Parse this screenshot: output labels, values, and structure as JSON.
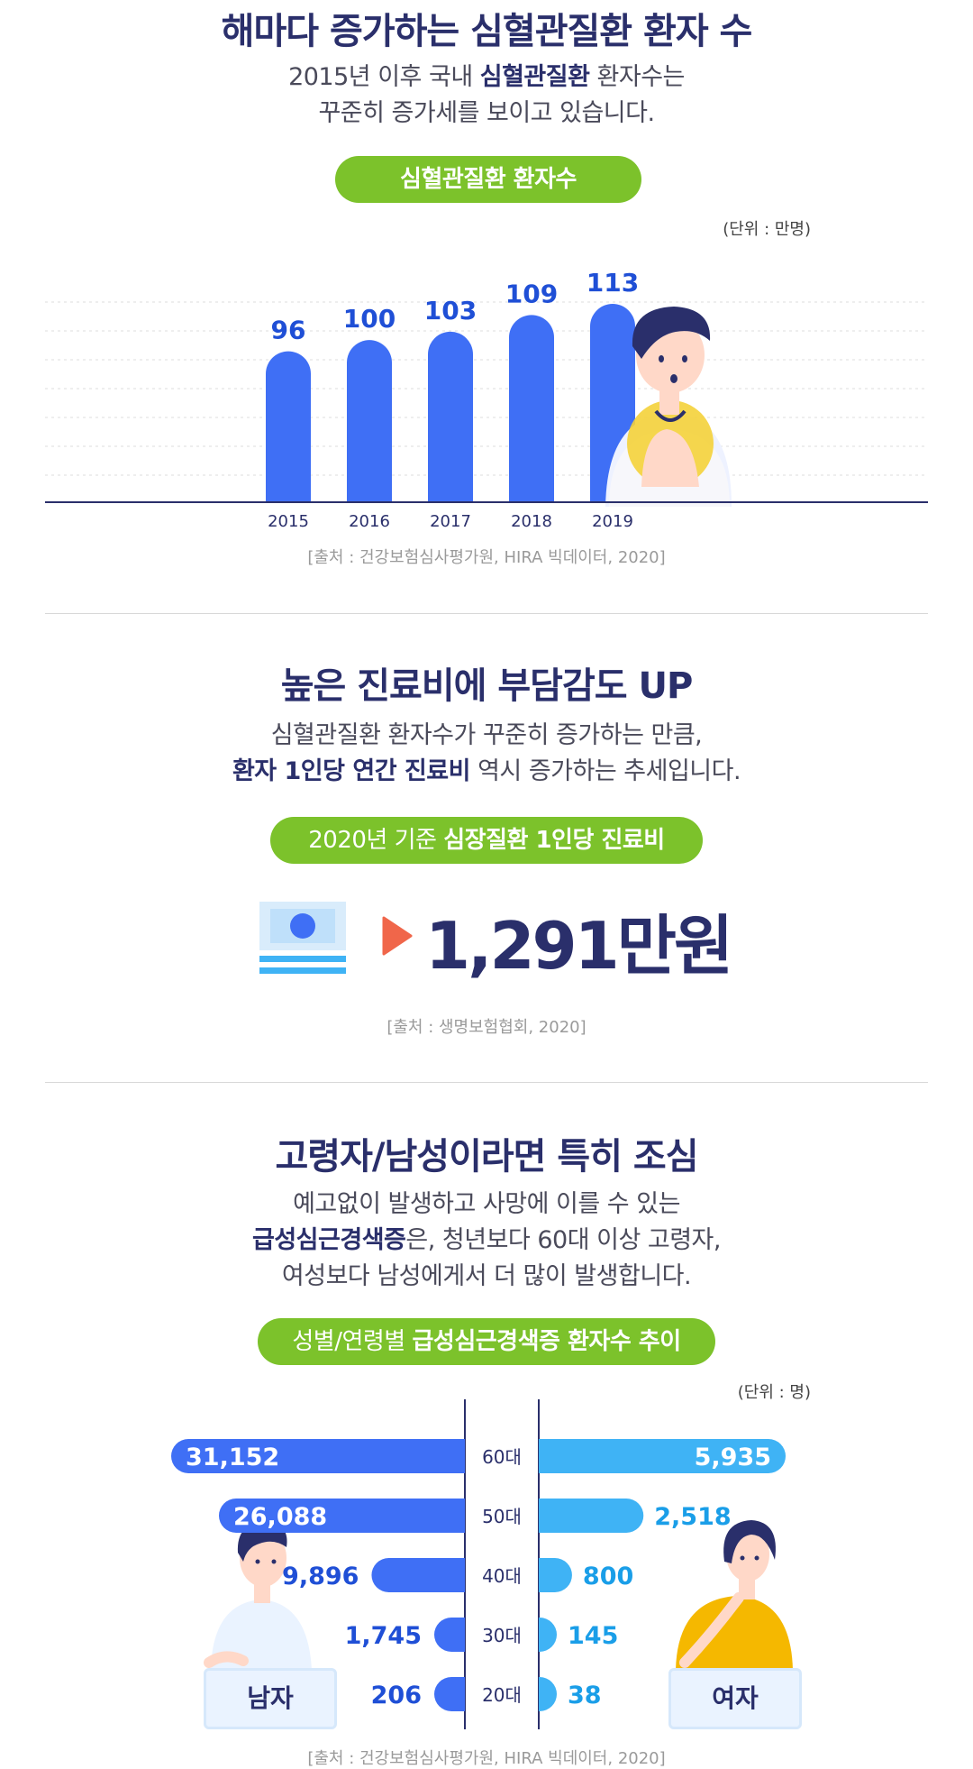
{
  "section1": {
    "title": "해마다 증가하는 심혈관질환 환자 수",
    "desc_line1_a": "2015년 이후 국내 ",
    "desc_line1_b": "심혈관질환",
    "desc_line1_c": " 환자수는",
    "desc_line2": "꾸준히 증가세를 보이고 있습니다.",
    "pill": "심혈관질환 환자수",
    "unit": "(단위 : 만명)",
    "source": "[출처 : 건강보험심사평가원, HIRA 빅데이터, 2020]"
  },
  "chart_data": [
    {
      "type": "bar",
      "title": "심혈관질환 환자수",
      "categories": [
        "2015",
        "2016",
        "2017",
        "2018",
        "2019"
      ],
      "values": [
        96,
        100,
        103,
        109,
        113
      ],
      "unit": "(단위 : 만명)",
      "colors": {
        "bar": "#3f6ff5",
        "label": "#1f4fd6",
        "axis": "#2a2f6b",
        "grid": "#dcdcdc"
      }
    },
    {
      "type": "bar",
      "title": "성별/연령별 급성심근경색증 환자수 추이",
      "categories": [
        "60대",
        "50대",
        "40대",
        "30대",
        "20대"
      ],
      "series": [
        {
          "name": "남자",
          "values": [
            31152,
            26088,
            9896,
            1745,
            206
          ]
        },
        {
          "name": "여자",
          "values": [
            5935,
            2518,
            800,
            145,
            38
          ]
        }
      ],
      "value_labels": {
        "male": [
          "31,152",
          "26,088",
          "9,896",
          "1,745",
          "206"
        ],
        "female": [
          "5,935",
          "2,518",
          "800",
          "145",
          "38"
        ]
      },
      "unit": "(단위 : 명)",
      "colors": {
        "male": "#3f6ff5",
        "female": "#3fb3f5",
        "male_text": "#1f4fd6",
        "female_text": "#1a9ee8"
      }
    }
  ],
  "section2": {
    "title": "높은 진료비에 부담감도 UP",
    "desc_line1": "심혈관질환 환자수가 꾸준히 증가하는 만큼,",
    "desc_line2_a": "환자 1인당 연간 진료비",
    "desc_line2_b": " 역시 증가하는 추세입니다.",
    "pill_a": "2020년 기준 ",
    "pill_b": "심장질환 1인당 진료비",
    "amount": "1,291만원",
    "source": "[출처 : 생명보험협회, 2020]"
  },
  "section3": {
    "title": "고령자/남성이라면 특히 조심",
    "desc_line1": "예고없이 발생하고 사망에 이를 수 있는",
    "desc_line2_a": "급성심근경색증",
    "desc_line2_b": "은, 청년보다 60대 이상 고령자,",
    "desc_line3": "여성보다 남성에게서 더 많이 발생합니다.",
    "pill_a": "성별/연령별 ",
    "pill_b": "급성심근경색증 환자수 추이",
    "unit": "(단위 : 명)",
    "male_label": "남자",
    "female_label": "여자",
    "source": "[출처 : 건강보험심사평가원, HIRA 빅데이터, 2020]"
  },
  "colors": {
    "navy": "#2a2f6b",
    "green": "#7cc22b",
    "blue": "#3f6ff5",
    "skyblue": "#3fb3f5",
    "arrow": "#f0664a"
  }
}
